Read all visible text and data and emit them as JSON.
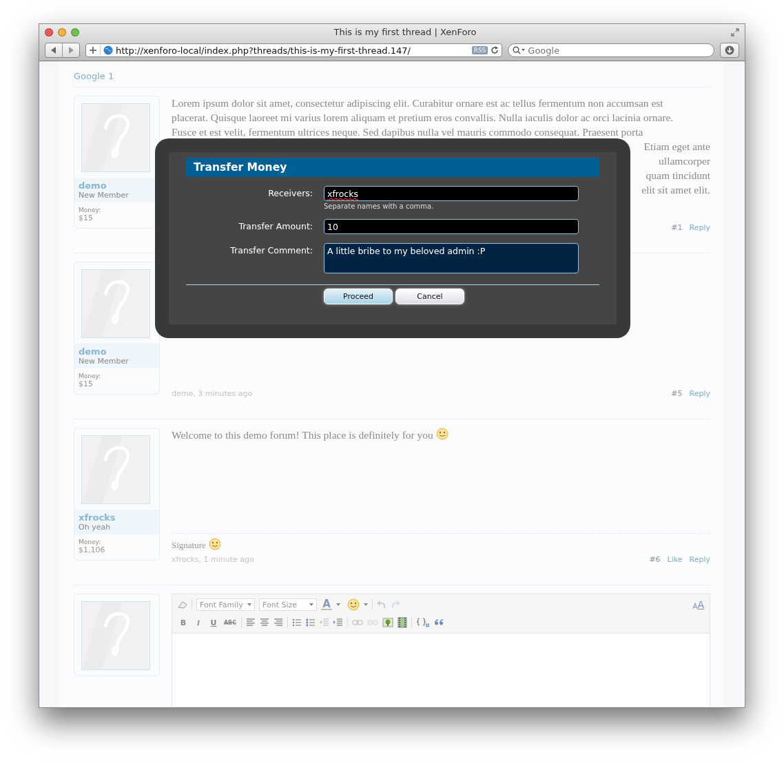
{
  "window": {
    "title": "This is my first thread | XenForo",
    "url": "http://xenforo-local/index.php?threads/this-is-my-first-thread.147/",
    "rss": "RSS",
    "search_placeholder": "Google"
  },
  "breadcrumb": "Google 1",
  "posts": [
    {
      "user": {
        "name": "demo",
        "title": "New Member",
        "money_label": "Money:",
        "money": "$15"
      },
      "lines": [
        {
          "text": "Lorem ipsum dolor sit amet, consectetur adipiscing elit. Curabitur ornare est ac tellus fermentum non accumsan est"
        },
        {
          "text": "placerat. Quisque laoreet mi varius lorem aliquam et pretium eros convallis. Nulla iaculis dolor ac orci lacinia ornare."
        },
        {
          "text": "Fusce et est velit, fermentum ultrices neque. Sed dapibus nulla vel mauris commodo consequat. Praesent porta"
        },
        {
          "tail": "Etiam eget ante"
        },
        {
          "tail": "ullamcorper"
        },
        {
          "tail": "quam tincidunt"
        },
        {
          "tail": "elit sit amet elit."
        }
      ],
      "number": "#1",
      "actions": [
        "Reply"
      ]
    },
    {
      "user": {
        "name": "demo",
        "title": "New Member",
        "money_label": "Money:",
        "money": "$15"
      },
      "meta": "demo, 3 minutes ago",
      "number": "#5",
      "actions": [
        "Reply"
      ]
    },
    {
      "user": {
        "name": "xfrocks",
        "title": "Oh yeah",
        "money_label": "Money:",
        "money": "$1,106"
      },
      "lines": [
        {
          "text": "Welcome to this demo forum! This place is definitely for you",
          "smiley": true
        }
      ],
      "signature": {
        "text": "Signature",
        "smiley": true
      },
      "meta": "xfrocks, 1 minute ago",
      "number": "#6",
      "actions": [
        "Like",
        "Reply"
      ]
    }
  ],
  "editor": {
    "font_family": "Font Family",
    "font_size": "Font Size",
    "color_glyph": "A",
    "toggle_glyphs": [
      "A",
      "A"
    ],
    "format_glyphs": [
      "B",
      "I",
      "U",
      "ABC"
    ]
  },
  "dialog": {
    "title": "Transfer Money",
    "fields": [
      {
        "kind": "input",
        "label": "Receivers:",
        "value": "xfrocks",
        "hint": "Separate names with a comma."
      },
      {
        "kind": "input",
        "label": "Transfer Amount:",
        "value": "10"
      },
      {
        "kind": "textarea",
        "label": "Transfer Comment:",
        "value": "A little bribe to my beloved admin :P"
      }
    ],
    "buttons": [
      {
        "label": "Proceed",
        "primary": true
      },
      {
        "label": "Cancel",
        "primary": false
      }
    ]
  }
}
